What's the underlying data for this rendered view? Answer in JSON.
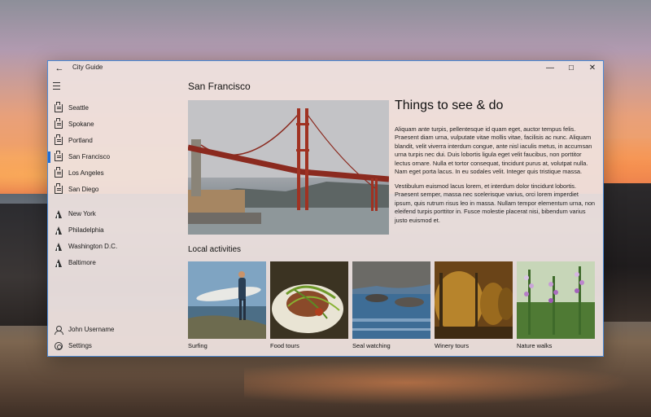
{
  "window": {
    "title": "City Guide",
    "back_glyph": "←",
    "minimize_glyph": "—",
    "maximize_glyph": "☐",
    "close_glyph": "✕",
    "accent_color": "#1f6ed4"
  },
  "sidebar": {
    "menu_icon": "hamburger-icon",
    "items": [
      {
        "label": "Seattle",
        "icon": "city-icon"
      },
      {
        "label": "Spokane",
        "icon": "city-icon"
      },
      {
        "label": "Portland",
        "icon": "city-icon"
      },
      {
        "label": "San Francisco",
        "icon": "city-icon",
        "selected": true
      },
      {
        "label": "Los Angeles",
        "icon": "city-icon"
      },
      {
        "label": "San Diego",
        "icon": "city-icon"
      },
      {
        "label": "New York",
        "icon": "tower-icon"
      },
      {
        "label": "Philadelphia",
        "icon": "tower-icon"
      },
      {
        "label": "Washington D.C.",
        "icon": "tower-icon"
      },
      {
        "label": "Baltimore",
        "icon": "tower-icon"
      }
    ],
    "footer": [
      {
        "label": "John Username",
        "icon": "user-icon"
      },
      {
        "label": "Settings",
        "icon": "gear-icon"
      }
    ]
  },
  "main": {
    "page_title": "San Francisco",
    "hero_image": "golden-gate-bridge-photo",
    "section_title": "Things to see & do",
    "paragraphs": [
      "Aliquam ante turpis, pellentesque id quam eget, auctor tempus felis. Praesent diam urna, vulputate vitae mollis vitae, facilisis ac nunc. Aliquam blandit, velit viverra interdum congue, ante nisl iaculis metus, in accumsan urna turpis nec dui. Duis lobortis ligula eget velit faucibus, non porttitor lectus ornare. Nulla et tortor consequat, tincidunt purus at, volutpat nulla. Nam eget porta lacus. In eu sodales velit. Integer quis tristique massa.",
      "Vestibulum euismod lacus lorem, et interdum dolor tincidunt lobortis. Praesent semper, massa nec scelerisque varius, orci lorem imperdiet ipsum, quis rutrum risus leo in massa. Nullam tempor elementum urna, non eleifend turpis porttitor in. Fusce molestie placerat nisi, bibendum varius justo euismod et."
    ],
    "local_title": "Local activities",
    "activities": [
      {
        "label": "Surfing",
        "image": "surfer-photo"
      },
      {
        "label": "Food tours",
        "image": "food-photo"
      },
      {
        "label": "Seal watching",
        "image": "seals-photo"
      },
      {
        "label": "Winery tours",
        "image": "barrels-photo"
      },
      {
        "label": "Nature walks",
        "image": "flowers-photo"
      }
    ]
  }
}
